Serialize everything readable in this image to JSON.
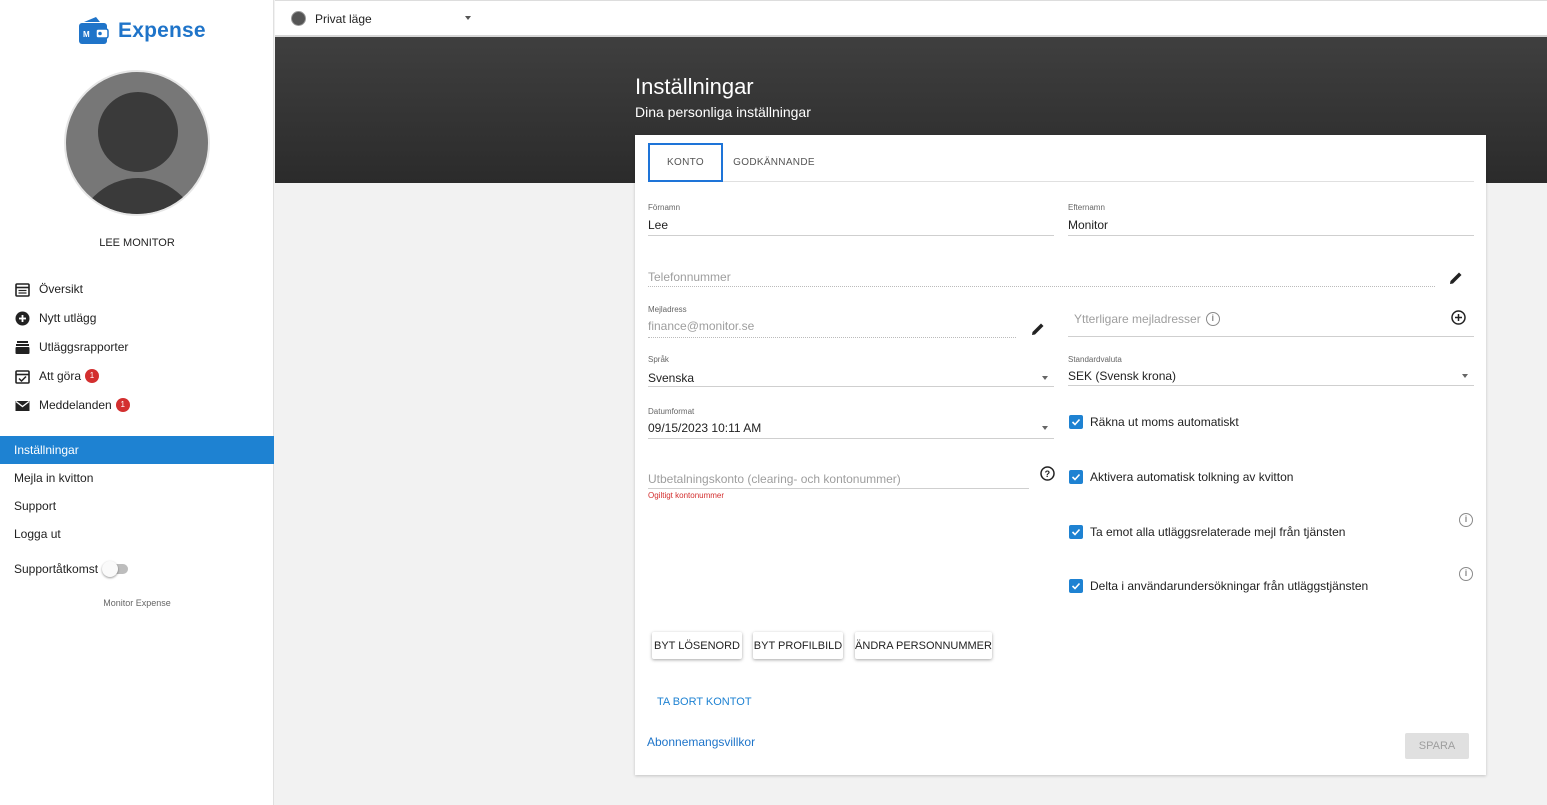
{
  "app": {
    "brand": "Expense",
    "user_name": "LEE MONITOR",
    "footer": "Monitor Expense",
    "accent": "#1e82d2"
  },
  "topbar": {
    "mode_label": "Privat läge"
  },
  "sidebar": {
    "items": [
      {
        "label": "Översikt",
        "icon": "calendar-icon"
      },
      {
        "label": "Nytt utlägg",
        "icon": "plus-circle-icon"
      },
      {
        "label": "Utläggsrapporter",
        "icon": "inbox-icon"
      },
      {
        "label": "Att göra",
        "icon": "calendar-check-icon",
        "badge": "1"
      },
      {
        "label": "Meddelanden",
        "icon": "mail-icon",
        "badge": "1"
      }
    ],
    "links": [
      {
        "label": "Inställningar",
        "active": true
      },
      {
        "label": "Mejla in kvitton"
      },
      {
        "label": "Support"
      },
      {
        "label": "Logga ut"
      }
    ],
    "support_toggle": {
      "label": "Supportåtkomst",
      "on": false
    }
  },
  "page": {
    "title": "Inställningar",
    "subtitle": "Dina personliga inställningar"
  },
  "tabs": [
    {
      "label": "KONTO",
      "active": true
    },
    {
      "label": "GODKÄNNANDE"
    }
  ],
  "form": {
    "first_name": {
      "label": "Förnamn",
      "value": "Lee"
    },
    "last_name": {
      "label": "Efternamn",
      "value": "Monitor"
    },
    "phone": {
      "placeholder": "Telefonnummer"
    },
    "email": {
      "label": "Mejladress",
      "value": "finance@monitor.se"
    },
    "extra_emails": {
      "placeholder": "Ytterligare mejladresser"
    },
    "language": {
      "label": "Språk",
      "value": "Svenska"
    },
    "currency": {
      "label": "Standardvaluta",
      "value": "SEK (Svensk krona)"
    },
    "date_format": {
      "label": "Datumformat",
      "value": "09/15/2023 10:11 AM"
    },
    "payout_account": {
      "placeholder": "Utbetalningskonto (clearing- och kontonummer)",
      "error": "Ogiltigt kontonummer"
    },
    "checkboxes": [
      {
        "label": "Räkna ut moms automatiskt",
        "checked": true
      },
      {
        "label": "Aktivera automatisk tolkning av kvitton",
        "checked": true
      },
      {
        "label": "Ta emot alla utläggsrelaterade mejl från tjänsten",
        "checked": true
      },
      {
        "label": "Delta i användarundersökningar från utläggstjänsten",
        "checked": true
      }
    ]
  },
  "buttons": {
    "change_password": "BYT LÖSENORD",
    "change_picture": "BYT PROFILBILD",
    "change_ssn": "ÄNDRA PERSONNUMMER",
    "delete_account": "TA BORT KONTOT",
    "terms": "Abonnemangsvillkor",
    "save": "SPARA"
  }
}
